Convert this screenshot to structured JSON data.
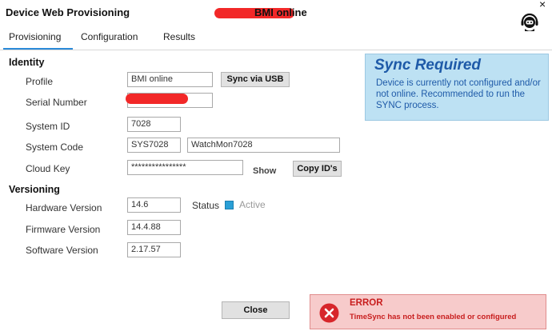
{
  "window": {
    "title": "Device Web Provisioning",
    "device_name_visible": "BMI online",
    "close_glyph": "×",
    "help_icon": "support-agent-icon"
  },
  "tabs": [
    {
      "label": "Provisioning",
      "active": true
    },
    {
      "label": "Configuration",
      "active": false
    },
    {
      "label": "Results",
      "active": false
    }
  ],
  "identity": {
    "heading": "Identity",
    "profile": {
      "label": "Profile",
      "value": "BMI online"
    },
    "sync_usb_button": "Sync via USB",
    "serial_number": {
      "label": "Serial Number",
      "value": ""
    },
    "system_id": {
      "label": "System ID",
      "value": "7028"
    },
    "system_code": {
      "label": "System Code",
      "code": "SYS7028",
      "name": "WatchMon7028"
    },
    "cloud_key": {
      "label": "Cloud Key",
      "value": "****************",
      "show_label": "Show"
    },
    "copy_ids_button": "Copy ID's"
  },
  "versioning": {
    "heading": "Versioning",
    "hardware": {
      "label": "Hardware Version",
      "value": "14.6"
    },
    "firmware": {
      "label": "Firmware Version",
      "value": "14.4.88"
    },
    "software": {
      "label": "Software Version",
      "value": "2.17.57"
    },
    "status_label": "Status",
    "status_value": "Active"
  },
  "sync_panel": {
    "title": "Sync Required",
    "message": "Device is currently not configured and/or not online. Recommended to run the SYNC process."
  },
  "footer": {
    "close_button": "Close"
  },
  "error_panel": {
    "title": "ERROR",
    "message": "TimeSync has not been enabled or configured"
  },
  "colors": {
    "accent": "#2b8ad8",
    "sync_bg": "#bde1f3",
    "sync_text": "#1e5aa8",
    "error_bg": "#f7cbcb",
    "error_text": "#c81e1e",
    "status_indicator": "#2a9fd6"
  }
}
